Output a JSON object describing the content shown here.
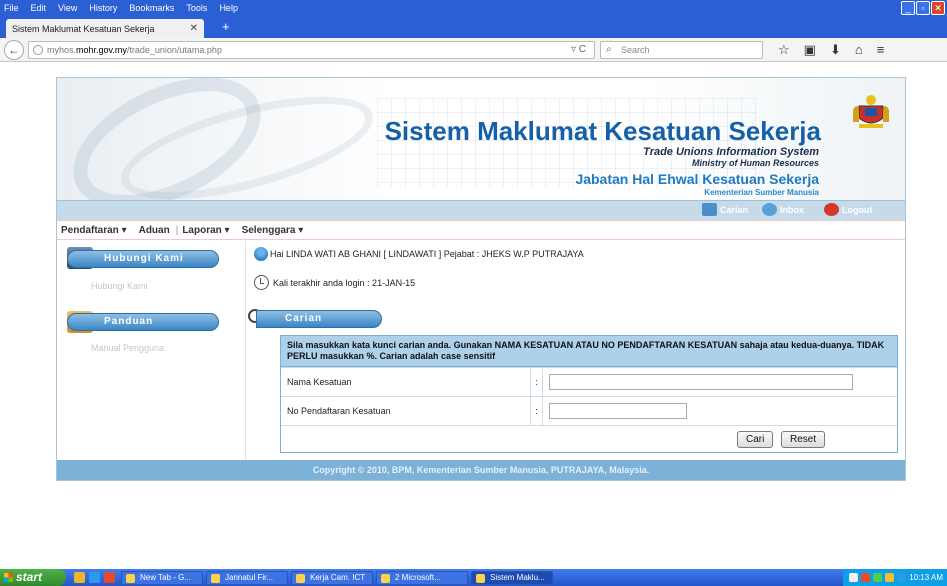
{
  "browser": {
    "menu": [
      "File",
      "Edit",
      "View",
      "History",
      "Bookmarks",
      "Tools",
      "Help"
    ],
    "tab_title": "Sistem Maklumat Kesatuan Sekerja",
    "tab_close": "✕",
    "new_tab": "+",
    "url_prefix": "myhos.",
    "url_host": "mohr.gov.my",
    "url_path": "/trade_union/utama.php",
    "search_placeholder": "Search",
    "window_buttons": [
      "_",
      "▫",
      "✕"
    ]
  },
  "banner": {
    "title": "Sistem Maklumat Kesatuan Sekerja",
    "subtitle": "Trade Unions Information System",
    "subtitle2": "Ministry of Human Resources",
    "department": "Jabatan Hal Ehwal Kesatuan Sekerja",
    "ministry": "Kementerian Sumber Manusia"
  },
  "utility": {
    "search": "Carian",
    "inbox": "Inbox",
    "logout": "Logout"
  },
  "menu": {
    "items": [
      "Pendaftaran ▾",
      "Aduan",
      "Laporan ▾",
      "Selenggara ▾"
    ]
  },
  "sidebar": {
    "contact_header": "Hubungi Kami",
    "contact_link": "Hubungi Kami",
    "guide_header": "Panduan",
    "guide_link": "Manual Pengguna"
  },
  "main": {
    "greeting": "Hai LINDA WATI AB GHANI [ LINDAWATI ] Pejabat : JHEKS W.P PUTRAJAYA",
    "last_login": "Kali terakhir anda login : 21-JAN-15",
    "search_tab": "Carian",
    "instructions": "Sila masukkan kata kunci carian anda. Gunakan NAMA KESATUAN ATAU NO PENDAFTARAN KESATUAN sahaja atau kedua-duanya. TIDAK PERLU masukkan %. Carian adalah case sensitif",
    "field1_label": "Nama Kesatuan",
    "field1_value": "",
    "field2_label": "No Pendaftaran Kesatuan",
    "field2_value": "",
    "colon": ":",
    "search_button": "Cari",
    "reset_button": "Reset"
  },
  "footer": {
    "text": "Copyright © 2010, BPM, Kementerian Sumber Manusia, PUTRAJAYA, Malaysia."
  },
  "taskbar": {
    "start": "start",
    "items": [
      "New Tab - G...",
      "Jannatul Fir...",
      "Kerja Cam. ICT",
      "2 Microsoft...",
      "Sistem Maklu..."
    ],
    "time": "10:13 AM"
  },
  "colors": {
    "brand_blue": "#1560a8",
    "accent": "#3b86c6",
    "footer": "#7cb1d8"
  }
}
